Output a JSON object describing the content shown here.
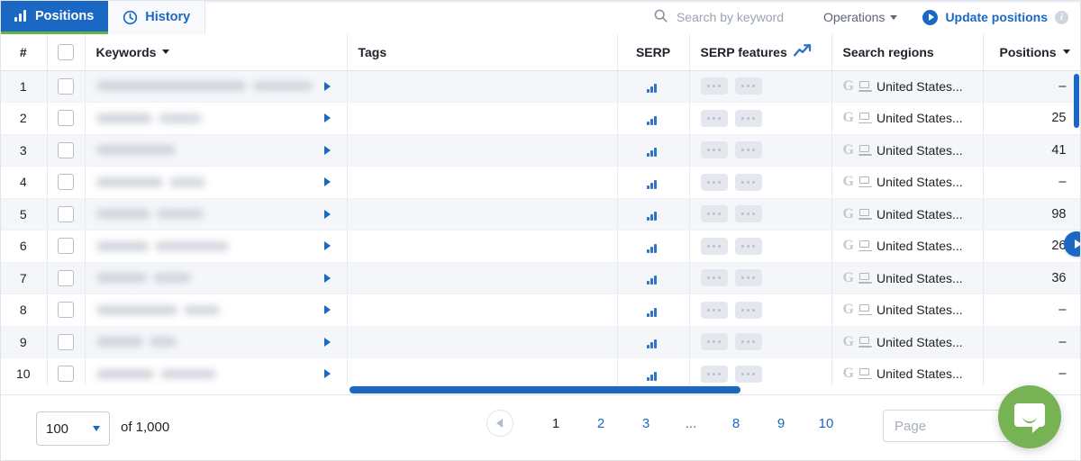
{
  "tabs": [
    {
      "label": "Positions",
      "icon": "bar-chart-icon",
      "active": true
    },
    {
      "label": "History",
      "icon": "clock-icon",
      "active": false
    }
  ],
  "toolbar": {
    "search_placeholder": "Search by keyword",
    "search_value": "",
    "search_icon": "search-icon",
    "operations_label": "Operations",
    "update_label": "Update positions",
    "update_icon": "play-circle-icon",
    "info_icon": "info-icon",
    "accent_blue": "#1b68c4",
    "accent_green": "#62b543"
  },
  "table": {
    "columns": [
      {
        "key": "num",
        "label": "#"
      },
      {
        "key": "chk",
        "label": ""
      },
      {
        "key": "keywords",
        "label": "Keywords",
        "sortable": true
      },
      {
        "key": "tags",
        "label": "Tags"
      },
      {
        "key": "serp",
        "label": "SERP"
      },
      {
        "key": "features",
        "label": "SERP features",
        "icon": "trend-up-icon"
      },
      {
        "key": "regions",
        "label": "Search regions"
      },
      {
        "key": "positions",
        "label": "Positions",
        "sortable": true
      }
    ],
    "rows": [
      {
        "num": "1",
        "keyword_redacted": true,
        "kw_w1": 180,
        "kw_w2": 72,
        "tags": "",
        "serp_icon": "bar-chart-icon",
        "features": [
          "...",
          "..."
        ],
        "region_engine": "G",
        "region_device": "desktop-icon",
        "region": "United States...",
        "position": "–"
      },
      {
        "num": "2",
        "keyword_redacted": true,
        "kw_w1": 62,
        "kw_w2": 48,
        "tags": "",
        "serp_icon": "bar-chart-icon",
        "features": [
          "...",
          "..."
        ],
        "region_engine": "G",
        "region_device": "desktop-icon",
        "region": "United States...",
        "position": "25"
      },
      {
        "num": "3",
        "keyword_redacted": true,
        "kw_w1": 88,
        "kw_w2": 0,
        "tags": "",
        "serp_icon": "bar-chart-icon",
        "features": [
          "...",
          "..."
        ],
        "region_engine": "G",
        "region_device": "desktop-icon",
        "region": "United States...",
        "position": "41"
      },
      {
        "num": "4",
        "keyword_redacted": true,
        "kw_w1": 74,
        "kw_w2": 40,
        "tags": "",
        "serp_icon": "bar-chart-icon",
        "features": [
          "...",
          "..."
        ],
        "region_engine": "G",
        "region_device": "desktop-icon",
        "region": "United States...",
        "position": "–"
      },
      {
        "num": "5",
        "keyword_redacted": true,
        "kw_w1": 60,
        "kw_w2": 52,
        "tags": "",
        "serp_icon": "bar-chart-icon",
        "features": [
          "...",
          "..."
        ],
        "region_engine": "G",
        "region_device": "desktop-icon",
        "region": "United States...",
        "position": "98"
      },
      {
        "num": "6",
        "keyword_redacted": true,
        "kw_w1": 58,
        "kw_w2": 82,
        "tags": "",
        "serp_icon": "bar-chart-icon",
        "features": [
          "...",
          "..."
        ],
        "region_engine": "G",
        "region_device": "desktop-icon",
        "region": "United States...",
        "position": "26"
      },
      {
        "num": "7",
        "keyword_redacted": true,
        "kw_w1": 56,
        "kw_w2": 42,
        "tags": "",
        "serp_icon": "bar-chart-icon",
        "features": [
          "...",
          "..."
        ],
        "region_engine": "G",
        "region_device": "desktop-icon",
        "region": "United States...",
        "position": "36"
      },
      {
        "num": "8",
        "keyword_redacted": true,
        "kw_w1": 90,
        "kw_w2": 40,
        "tags": "",
        "serp_icon": "bar-chart-icon",
        "features": [
          "...",
          "..."
        ],
        "region_engine": "G",
        "region_device": "desktop-icon",
        "region": "United States...",
        "position": "–"
      },
      {
        "num": "9",
        "keyword_redacted": true,
        "kw_w1": 52,
        "kw_w2": 30,
        "tags": "",
        "serp_icon": "bar-chart-icon",
        "features": [
          "...",
          "..."
        ],
        "region_engine": "G",
        "region_device": "desktop-icon",
        "region": "United States...",
        "position": "–"
      },
      {
        "num": "10",
        "keyword_redacted": true,
        "kw_w1": 64,
        "kw_w2": 62,
        "tags": "",
        "serp_icon": "bar-chart-icon",
        "features": [
          "...",
          "..."
        ],
        "region_engine": "G",
        "region_device": "desktop-icon",
        "region": "United States...",
        "position": "–"
      }
    ]
  },
  "footer": {
    "page_size": "100",
    "total_label": "of 1,000",
    "prev_icon": "chevron-left-icon",
    "pages": [
      {
        "label": "1",
        "current": true
      },
      {
        "label": "2",
        "current": false
      },
      {
        "label": "3",
        "current": false
      },
      {
        "label": "...",
        "current": false,
        "ellipsis": true
      },
      {
        "label": "8",
        "current": false
      },
      {
        "label": "9",
        "current": false
      },
      {
        "label": "10",
        "current": false
      }
    ],
    "page_input_placeholder": "Page",
    "page_input_value": ""
  },
  "chat": {
    "icon": "chat-bubble-icon",
    "color": "#77b255"
  },
  "scroll": {
    "vertical_thumb": true,
    "horizontal_thumb": true,
    "right_nav_icon": "chevron-right-icon"
  }
}
